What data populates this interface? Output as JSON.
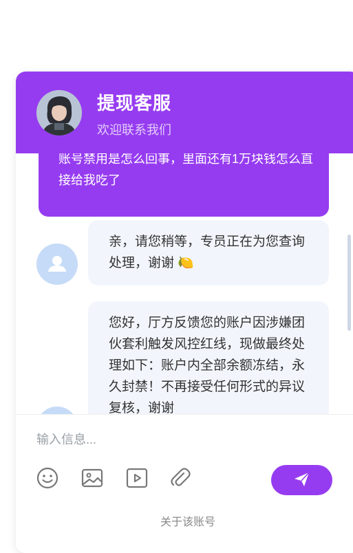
{
  "header": {
    "title": "提现客服",
    "subtitle": "欢迎联系我们",
    "avatar_icon": "user-photo-avatar"
  },
  "messages": [
    {
      "sender": "user",
      "text": "账号禁用是怎么回事，里面还有1万块钱怎么直接给我吃了"
    },
    {
      "sender": "agent",
      "text": "亲，请您稍等，专员正在为您查询处理，谢谢 🍋"
    },
    {
      "sender": "agent",
      "text": "您好，厅方反馈您的账户因涉嫌团伙套利触发风控红线，现做最终处理如下：账户内全部余额冻结，永久封禁！不再接受任何形式的异议复核，谢谢"
    }
  ],
  "input": {
    "placeholder": "输入信息..."
  },
  "toolbar": {
    "icons": [
      "emoji-icon",
      "image-icon",
      "video-icon",
      "attachment-icon",
      "send-icon"
    ]
  },
  "footer": {
    "link": "关于该账号"
  },
  "colors": {
    "accent": "#963cf0",
    "agent_bubble": "#f2f6fc",
    "agent_avatar": "#c6dbf7"
  }
}
